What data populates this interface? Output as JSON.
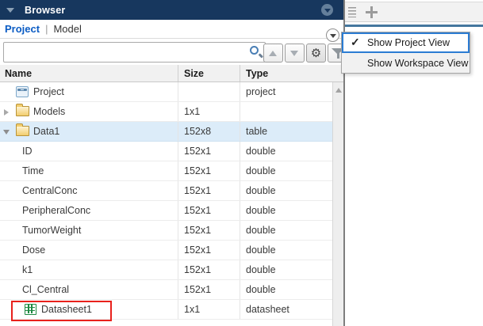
{
  "browser_panel": {
    "title": "Browser",
    "view_tabs": {
      "project": "Project",
      "separator": "|",
      "model": "Model"
    },
    "search": {
      "value": "",
      "placeholder": ""
    },
    "table": {
      "columns": [
        "Name",
        "Size",
        "Type"
      ],
      "rows": [
        {
          "name": "Project",
          "size": "",
          "type": "project",
          "icon": "project-icon",
          "indent": 1
        },
        {
          "name": "Models",
          "size": "1x1",
          "type": "",
          "icon": "folder-icon",
          "indent": 1,
          "expander": "collapsed"
        },
        {
          "name": "Data1",
          "size": "152x8",
          "type": "table",
          "icon": "folder-icon",
          "indent": 1,
          "expander": "expanded",
          "selected": true
        },
        {
          "name": "ID",
          "size": "152x1",
          "type": "double",
          "icon": "none",
          "indent": 2
        },
        {
          "name": "Time",
          "size": "152x1",
          "type": "double",
          "icon": "none",
          "indent": 2
        },
        {
          "name": "CentralConc",
          "size": "152x1",
          "type": "double",
          "icon": "none",
          "indent": 2
        },
        {
          "name": "PeripheralConc",
          "size": "152x1",
          "type": "double",
          "icon": "none",
          "indent": 2
        },
        {
          "name": "TumorWeight",
          "size": "152x1",
          "type": "double",
          "icon": "none",
          "indent": 2
        },
        {
          "name": "Dose",
          "size": "152x1",
          "type": "double",
          "icon": "none",
          "indent": 2
        },
        {
          "name": "k1",
          "size": "152x1",
          "type": "double",
          "icon": "none",
          "indent": 2
        },
        {
          "name": "Cl_Central",
          "size": "152x1",
          "type": "double",
          "icon": "none",
          "indent": 2
        },
        {
          "name": "Datasheet1",
          "size": "1x1",
          "type": "datasheet",
          "icon": "datasheet-icon",
          "indent": 2,
          "annotated": true
        }
      ]
    }
  },
  "view_menu": {
    "check_glyph": "✓",
    "items": [
      {
        "label": "Show Project View",
        "checked": true
      },
      {
        "label": "Show Workspace View",
        "checked": false
      }
    ]
  },
  "toolbar_icons": {
    "gear_glyph": "⚙"
  },
  "right_panel": {
    "add_button_glyph": ""
  },
  "colors": {
    "title_bar": "#17375e",
    "link_blue": "#0b5cc4",
    "selected_row": "#dcecf9",
    "annotation_red": "#e8211c",
    "menu_selection_blue": "#2b7cd3",
    "right_tab_line": "#44779e",
    "folder_yellow": "#f3cd6d",
    "datasheet_green": "#1f8a43"
  }
}
